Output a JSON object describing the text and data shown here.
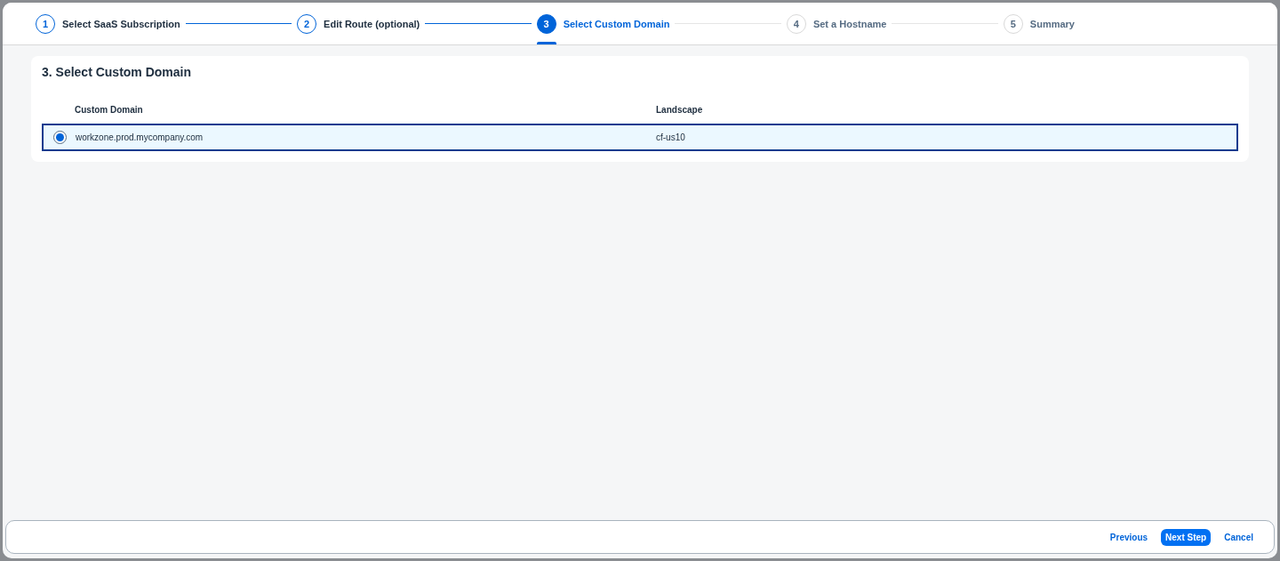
{
  "steps": [
    {
      "number": "1",
      "label": "Select SaaS Subscription",
      "completed": true,
      "selected": false
    },
    {
      "number": "2",
      "label": "Edit Route (optional)",
      "completed": true,
      "selected": false
    },
    {
      "number": "3",
      "label": "Select Custom Domain",
      "completed": false,
      "selected": true
    },
    {
      "number": "4",
      "label": "Set a Hostname",
      "completed": false,
      "selected": false
    },
    {
      "number": "5",
      "label": "Summary",
      "completed": false,
      "selected": false
    }
  ],
  "section": {
    "title": "3. Select Custom Domain"
  },
  "table": {
    "columns": [
      "Custom Domain",
      "Landscape"
    ],
    "rows": [
      {
        "cells": [
          "workzone.prod.mycompany.com",
          "cf-us10"
        ],
        "selected": true
      }
    ]
  },
  "footer": {
    "buttons": [
      {
        "label": "Previous",
        "kind": "link"
      },
      {
        "label": "Next Step",
        "kind": "primary"
      },
      {
        "label": "Cancel",
        "kind": "link"
      }
    ]
  }
}
